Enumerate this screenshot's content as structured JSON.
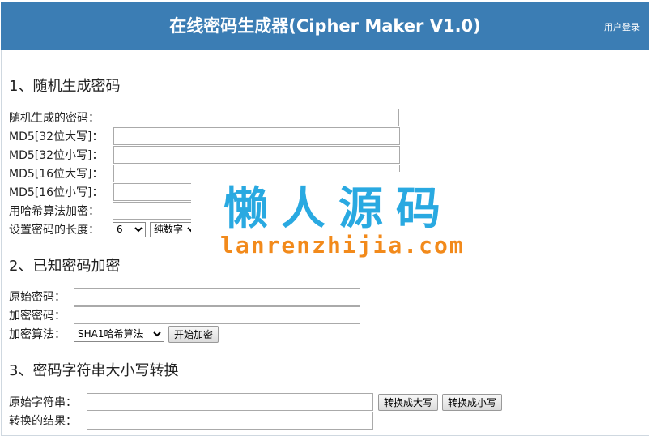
{
  "header": {
    "title": "在线密码生成器(Cipher Maker V1.0)",
    "login": "用户登录",
    "bg_color": "#3b7db4"
  },
  "section1": {
    "heading": "1、随机生成密码",
    "rows": [
      {
        "label": "随机生成的密码：",
        "value": ""
      },
      {
        "label": "MD5[32位大写]：",
        "value": ""
      },
      {
        "label": "MD5[32位小写]：",
        "value": ""
      },
      {
        "label": "MD5[16位大写]：",
        "value": ""
      },
      {
        "label": "MD5[16位小写]：",
        "value": ""
      },
      {
        "label": "用哈希算法加密：",
        "value": ""
      }
    ],
    "length_label": "设置密码的长度：",
    "length_value": "6",
    "charset_value": "纯数字"
  },
  "section2": {
    "heading": "2、已知密码加密",
    "original_label": "原始密码：",
    "original_value": "",
    "encrypted_label": "加密密码：",
    "encrypted_value": "",
    "algo_label": "加密算法：",
    "algo_value": "SHA1哈希算法",
    "encrypt_button": "开始加密"
  },
  "section3": {
    "heading": "3、密码字符串大小写转换",
    "source_label": "原始字符串：",
    "source_value": "",
    "upper_button": "转换成大写",
    "lower_button": "转换成小写",
    "result_label": "转换的结果：",
    "result_value": ""
  },
  "watermark": {
    "cn": "懒人源码",
    "en": "lanrenzhijia.com",
    "cn_color": "#29a9e1",
    "en_color": "#f28a1b"
  }
}
